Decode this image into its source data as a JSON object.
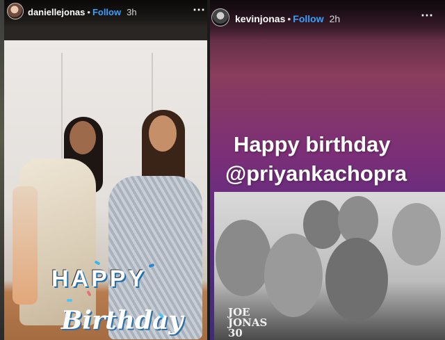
{
  "left_story": {
    "username": "daniellejonas",
    "follow_label": "Follow",
    "time": "3h",
    "more_icon": "⋯",
    "sticker_text_1": "HAPPY",
    "sticker_text_2": "Birthday"
  },
  "right_story": {
    "username": "kevinjonas",
    "follow_label": "Follow",
    "time": "2h",
    "more_icon": "⋯",
    "caption_line_1": "Happy birthday",
    "caption_line_2": "@priyankachopra",
    "photo_logo": "JOE\nJONAS\n30"
  },
  "colors": {
    "follow": "#3aa0ff",
    "caption_text": "#ffffff"
  }
}
